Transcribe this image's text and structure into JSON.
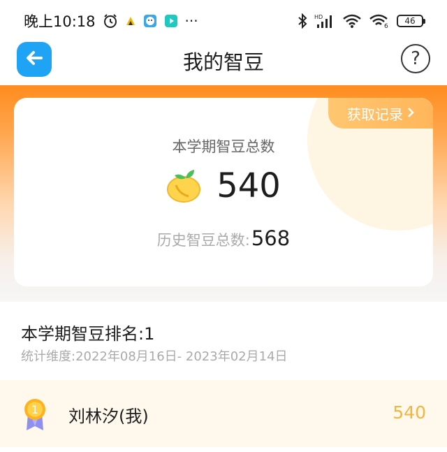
{
  "status_bar": {
    "time": "晚上10:18",
    "more": "···",
    "hd_label": "HD",
    "wifi6_label": "6",
    "battery": "46"
  },
  "header": {
    "title": "我的智豆",
    "help_label": "?"
  },
  "summary": {
    "record_label": "获取记录",
    "term_label": "本学期智豆总数",
    "term_value": "540",
    "history_label": "历史智豆总数:",
    "history_value": "568"
  },
  "ranking": {
    "title": "本学期智豆排名:1",
    "period": "统计维度:2022年08月16日- 2023年02月14日",
    "entries": [
      {
        "rank": "1",
        "name": "刘林汐(我)",
        "score": "540"
      }
    ]
  },
  "colors": {
    "accent_orange": "#ff8c1e",
    "back_button_blue": "#1fa3f4",
    "score_gold": "#f2b53d",
    "record_button": "#ffb65a"
  },
  "icons": [
    "back-arrow-icon",
    "help-icon",
    "bean-sprout-icon",
    "gold-medal-icon",
    "chevron-right-icon"
  ]
}
